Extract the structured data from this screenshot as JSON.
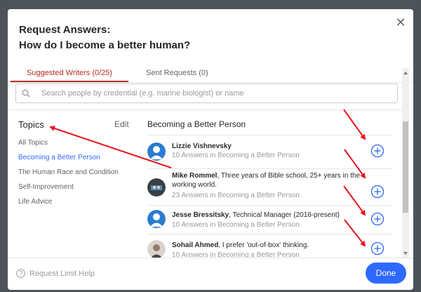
{
  "modal": {
    "title_line1": "Request Answers:",
    "title_line2": "How do I become a better human?",
    "close_icon": "close-icon"
  },
  "tabs": [
    {
      "label": "Suggested Writers (0/25)",
      "active": true
    },
    {
      "label": "Sent Requests (0)",
      "active": false
    }
  ],
  "search": {
    "placeholder": "Search people by credential (e.g. marine biologist) or name",
    "icon": "search-icon"
  },
  "topics": {
    "header": "Topics",
    "edit_label": "Edit",
    "items": [
      {
        "label": "All Topics",
        "active": false
      },
      {
        "label": "Becoming a Better Person",
        "active": true
      },
      {
        "label": "The Human Race and Condition",
        "active": false
      },
      {
        "label": "Self-Improvement",
        "active": false
      },
      {
        "label": "Life Advice",
        "active": false
      }
    ]
  },
  "writers": {
    "section_title": "Becoming a Better Person",
    "items": [
      {
        "name": "Lizzie Vishnevsky",
        "credential": "",
        "answers": "10 Answers in Becoming a Better Person"
      },
      {
        "name": "Mike Rommel",
        "credential": ", Three years of Bible school, 25+ years in the working world.",
        "answers": "23 Answers in Becoming a Better Person"
      },
      {
        "name": "Jesse Bressitsky",
        "credential": ", Technical Manager (2016-present)",
        "answers": "10 Answers in Becoming a Better Person"
      },
      {
        "name": "Sohail Ahmed",
        "credential": ", I prefer 'out-of-box' thinking.",
        "answers": "10 Answers in Becoming a Better Person"
      }
    ]
  },
  "footer": {
    "help_label": "Request Limit Help",
    "done_label": "Done"
  },
  "colors": {
    "accent_red": "#b92b27",
    "link_blue": "#2e69ff",
    "annotation_red": "#e8141c"
  }
}
